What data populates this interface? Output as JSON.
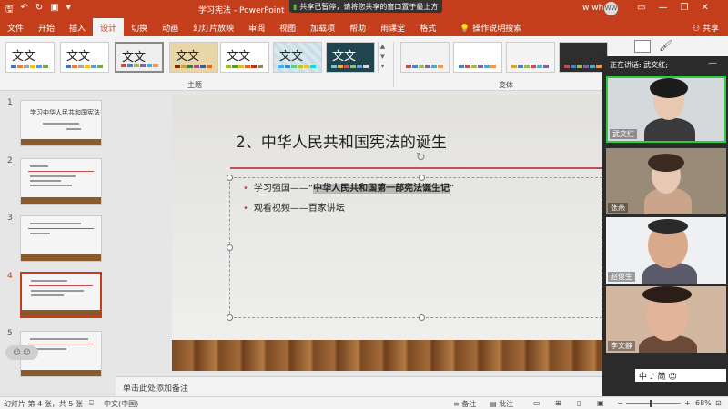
{
  "app": {
    "doc_title": "学习宪法 - PowerPoint",
    "share_banner": "共享已暂停，请将您共享的窗口置于最上方",
    "user_name": "w wh",
    "user_initials": "WW",
    "accent": "#c43e1c"
  },
  "tabs": [
    "文件",
    "开始",
    "插入",
    "设计",
    "切换",
    "动画",
    "幻灯片放映",
    "审阅",
    "视图",
    "加载项",
    "帮助",
    "雨课堂",
    "格式"
  ],
  "active_tab": "设计",
  "help_search": "操作说明搜索",
  "share_label": "共享",
  "ribbon": {
    "theme_sample_text": "文文",
    "themes_group_label": "主题",
    "variants_group_label": "变体"
  },
  "slides": {
    "numbers": [
      "1",
      "2",
      "3",
      "4",
      "5"
    ],
    "thumb1_title": "学习中华人民共和国宪法",
    "active": "4"
  },
  "current_slide": {
    "title": "2、中华人民共和国宪法的诞生",
    "bullet1_prefix": "学习强国——“",
    "bullet1_highlight": "中华人民共和国第一部宪法诞生记",
    "bullet1_suffix": "”",
    "bullet2": "观看视频——百家讲坛"
  },
  "notes_placeholder": "单击此处添加备注",
  "status": {
    "slide_info": "幻灯片 第 4 张，共 5 张",
    "language": "中文(中国)",
    "notes_btn": "备注",
    "comments_btn": "批注",
    "zoom": "68%"
  },
  "meeting": {
    "speaking_label": "正在讲话: 武文红;",
    "participants": [
      "武文红",
      "张燕",
      "赵俊生",
      "李文静"
    ],
    "toolbar_text": "中 ♪ 简 ☺"
  }
}
